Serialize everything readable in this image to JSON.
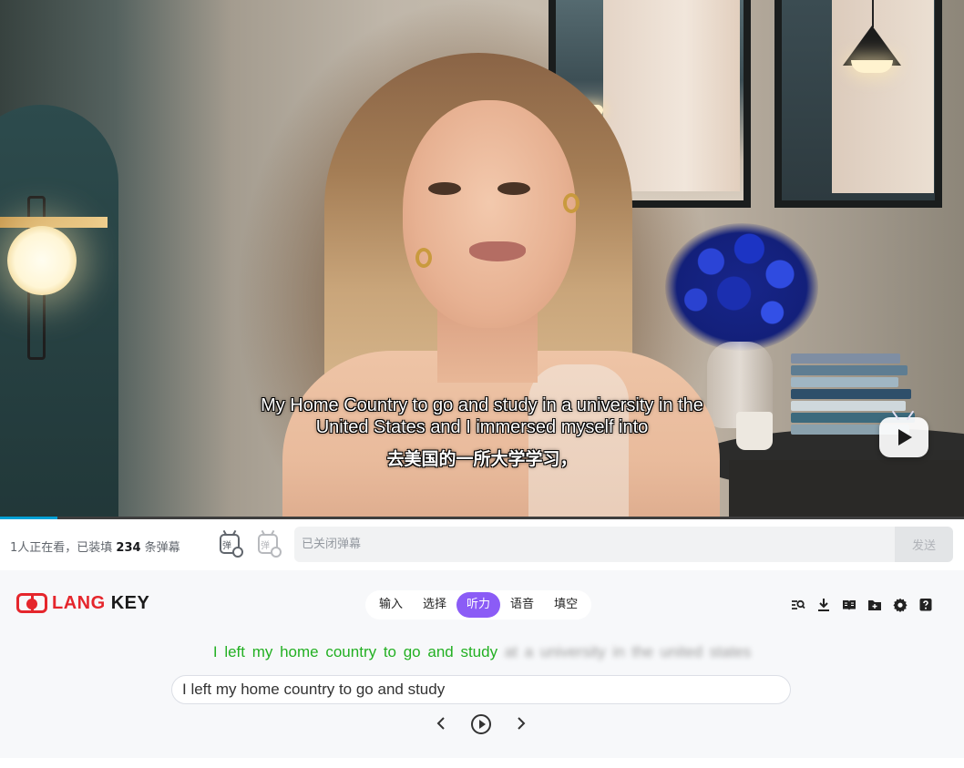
{
  "video": {
    "subtitle_en_line1": "My Home Country to go and study in a university  in the",
    "subtitle_en_line2": "United States and I immersed myself into",
    "subtitle_zh": "去美国的一所大学学习，",
    "progress_fraction": 0.06,
    "accent_color": "#00a1d6"
  },
  "danmaku": {
    "viewers_prefix": "1人正在看，已装填 ",
    "count": "234",
    "viewers_suffix": " 条弹幕",
    "toggle_icon_label": "弹",
    "settings_icon_label": "弹",
    "input_placeholder": "已关闭弹幕",
    "send_label": "发送"
  },
  "langkey": {
    "logo_lang": "LANG",
    "logo_key": "KEY",
    "brand_color": "#e5262c",
    "tabs": [
      {
        "label": "输入"
      },
      {
        "label": "选择"
      },
      {
        "label": "听力",
        "active": true
      },
      {
        "label": "语音"
      },
      {
        "label": "填空"
      }
    ],
    "active_tab_color": "#8b5cf6",
    "toolbar_icons": [
      "search-list-icon",
      "download-icon",
      "book-icon",
      "folder-icon",
      "gear-icon",
      "help-icon"
    ],
    "sentence_known": "I left my home country to go and study",
    "sentence_hidden": "at a university in the united states",
    "answer_value": "I left my home country to go and study"
  }
}
